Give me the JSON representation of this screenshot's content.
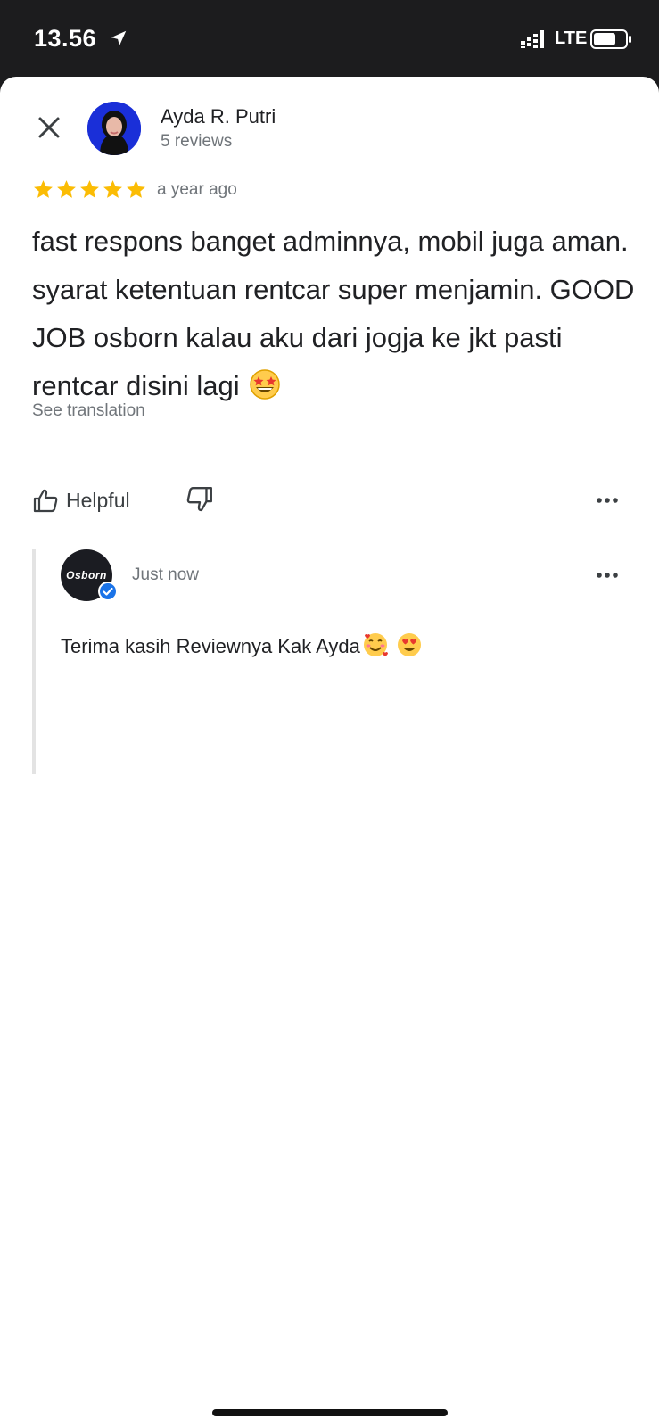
{
  "status_bar": {
    "time": "13.56",
    "network": "LTE"
  },
  "review": {
    "user_name": "Ayda R. Putri",
    "user_reviews": "5 reviews",
    "rating": 5,
    "time": "a year ago",
    "text": "fast respons banget adminnya, mobil juga aman. syarat ketentuan rentcar super menjamin. GOOD JOB osborn kalau aku dari jogja ke jkt pasti rentcar disini lagi",
    "see_translation": "See translation",
    "helpful_label": "Helpful"
  },
  "reply": {
    "owner_logo_text": "Osborn",
    "time": "Just now",
    "text": "Terima kasih Reviewnya Kak Ayda"
  },
  "colors": {
    "star": "#fbbc04",
    "verified": "#1a73e8",
    "avatar_bg": "#1a2fd8"
  },
  "icons": [
    "location-arrow-icon",
    "signal-icon",
    "battery-icon",
    "close-icon",
    "star-icon",
    "thumbs-up-icon",
    "thumbs-down-icon",
    "more-icon",
    "verified-icon",
    "star-struck-emoji",
    "smiling-hearts-emoji",
    "heart-eyes-emoji"
  ]
}
